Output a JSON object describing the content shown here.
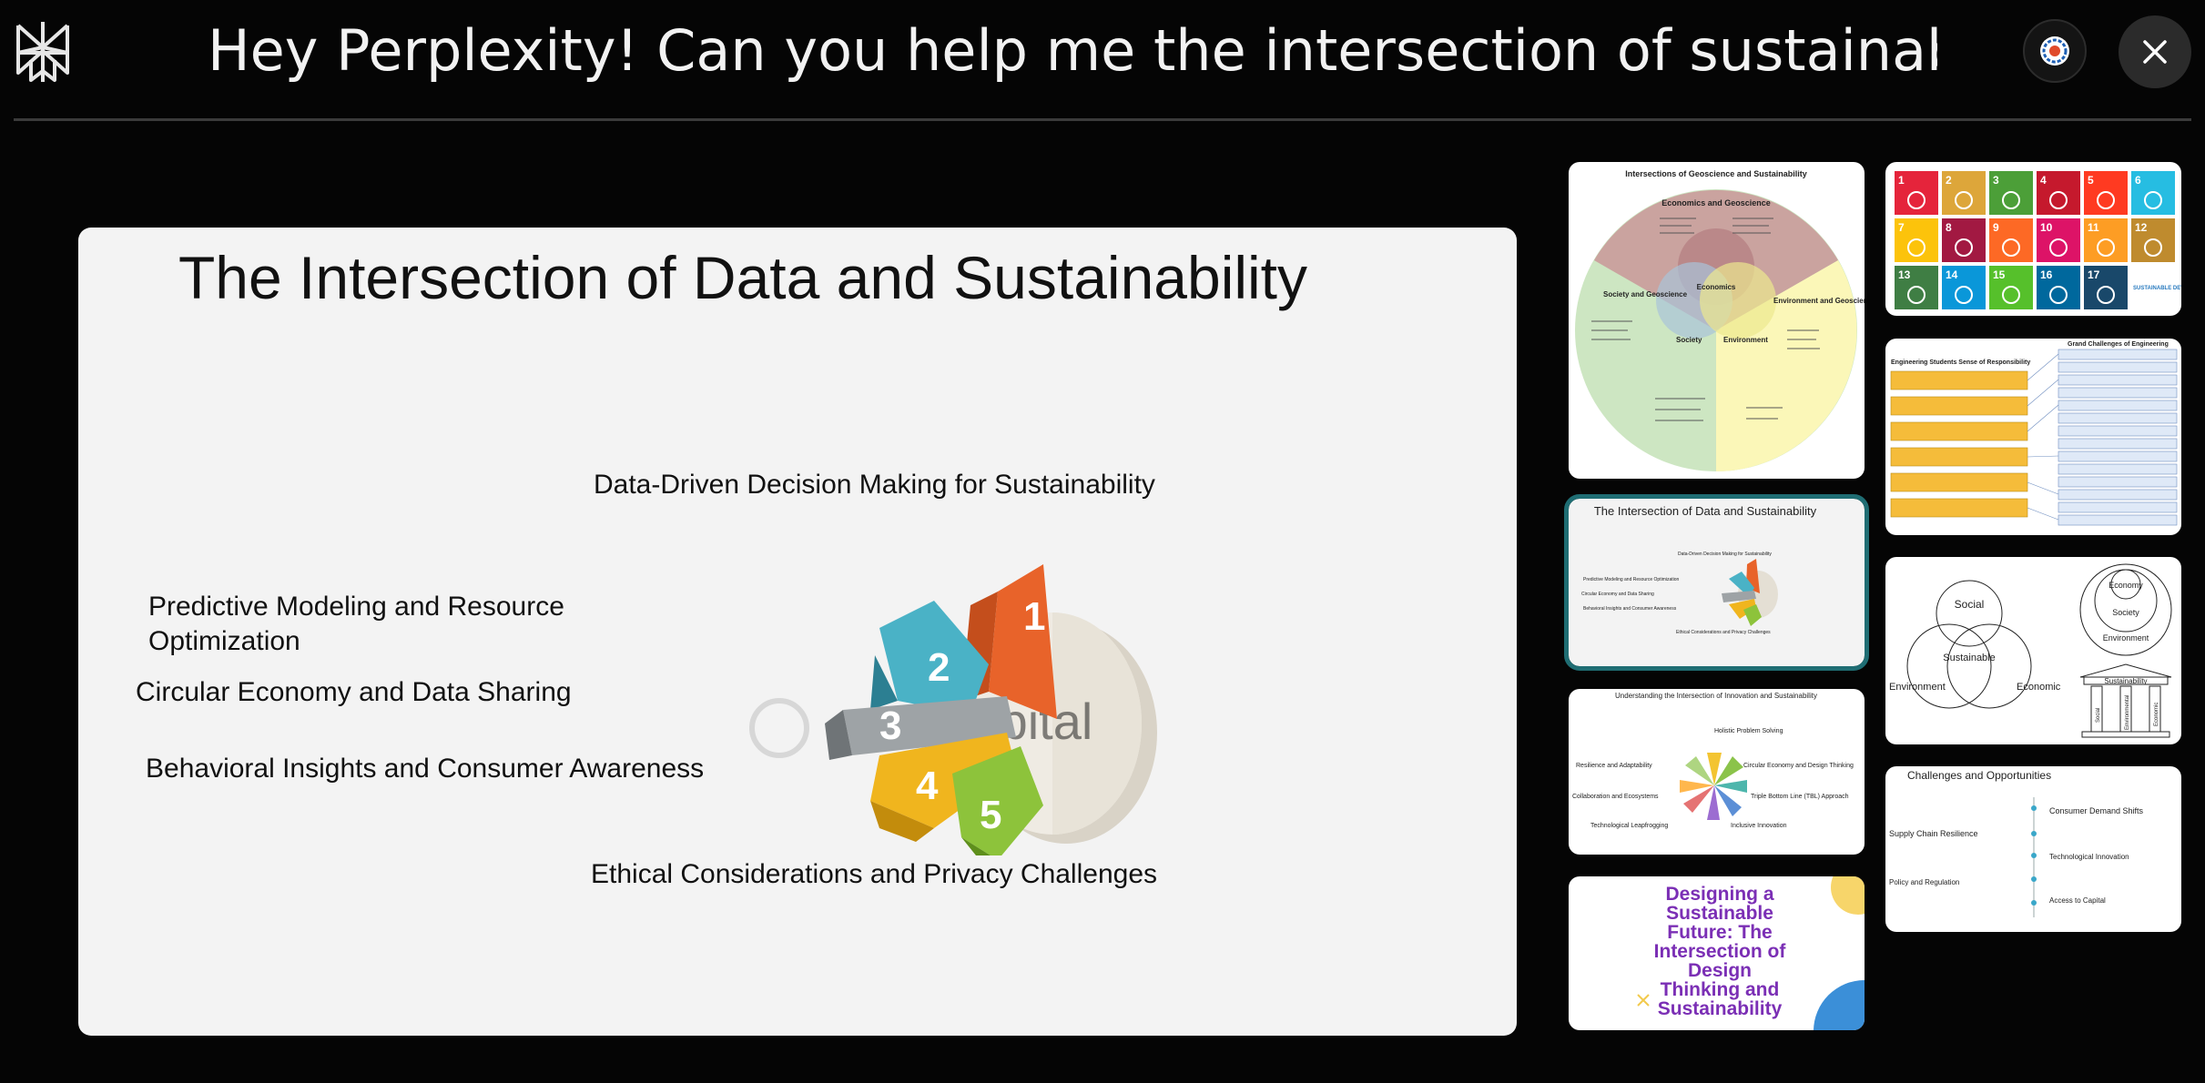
{
  "header": {
    "query": "Hey Perplexity! Can you help me the intersection of sustainability…",
    "source_icon": "sources-icon",
    "close_icon": "close-icon"
  },
  "main_slide": {
    "title": "The Intersection of Data and Sustainability",
    "labels": {
      "top": "Data-Driven Decision Making for Sustainability",
      "predictive": "Predictive Modeling and Resource Optimization",
      "circular": "Circular Economy and Data Sharing",
      "behavioral": "Behavioral Insights and Consumer Awareness",
      "ethical": "Ethical Considerations and Privacy Challenges"
    },
    "arrow_numbers": [
      "1",
      "2",
      "3",
      "4",
      "5"
    ],
    "watermark": "Capital"
  },
  "thumbnails": {
    "geoscience": {
      "title": "Intersections of Geoscience and Sustainability",
      "econ": "Economics and Geoscience",
      "society": "Society and Geoscience",
      "environment": "Environment and Geoscience",
      "center_econ": "Economics",
      "center_soc": "Society",
      "center_env": "Environment"
    },
    "sdg_grid": {
      "cells": [
        "1",
        "2",
        "3",
        "4",
        "5",
        "6",
        "7",
        "8",
        "9",
        "10",
        "11",
        "12",
        "13",
        "14",
        "15",
        "16",
        "17"
      ],
      "goals_label": "SUSTAINABLE DEVELOPMENT GOALS",
      "colors": [
        "#e5243b",
        "#dda63a",
        "#4c9f38",
        "#c5192d",
        "#ff3a21",
        "#26bde2",
        "#fcc30b",
        "#a21942",
        "#fd6925",
        "#dd1367",
        "#fd9d24",
        "#bf8b2e",
        "#3f7e44",
        "#0a97d9",
        "#56c02b",
        "#00689d",
        "#19486a"
      ]
    },
    "engineering": {
      "left_title": "Engineering Students Sense of Responsibility",
      "right_title": "Grand Challenges of Engineering"
    },
    "data_sustain": {
      "title": "The Intersection of Data and Sustainability",
      "top": "Data-Driven Decision Making for Sustainability",
      "l1": "Predictive Modeling and Resource Optimization",
      "l2": "Circular Economy and Data Sharing",
      "l3": "Behavioral Insights and Consumer Awareness",
      "bottom": "Ethical Considerations and Privacy Challenges"
    },
    "venn": {
      "social": "Social",
      "sustainable": "Sustainable",
      "environment": "Environment",
      "economic": "Economic",
      "n_economy": "Economy",
      "n_society": "Society",
      "n_environment": "Environment",
      "sustainability": "Sustainability",
      "pillar_social": "Social",
      "pillar_env": "Environmental",
      "pillar_econ": "Economic"
    },
    "innovation": {
      "title": "Understanding the Intersection of Innovation and Sustainability",
      "a": "Holistic Problem Solving",
      "b": "Resilience and Adaptability",
      "c": "Circular Economy and Design Thinking",
      "d": "Collaboration and Ecosystems",
      "e": "Triple Bottom Line (TBL) Approach",
      "f": "Technological Leapfrogging",
      "g": "Inclusive Innovation"
    },
    "challenges": {
      "title": "Challenges and Opportunities",
      "a": "Consumer Demand Shifts",
      "b": "Supply Chain Resilience",
      "c": "Technological Innovation",
      "d": "Policy and Regulation",
      "e": "Access to Capital"
    },
    "design": {
      "line1": "Designing a",
      "line2": "Sustainable",
      "line3": "Future: The",
      "line4": "Intersection of",
      "line5": "Design",
      "line6": "Thinking and",
      "line7": "Sustainability"
    }
  }
}
